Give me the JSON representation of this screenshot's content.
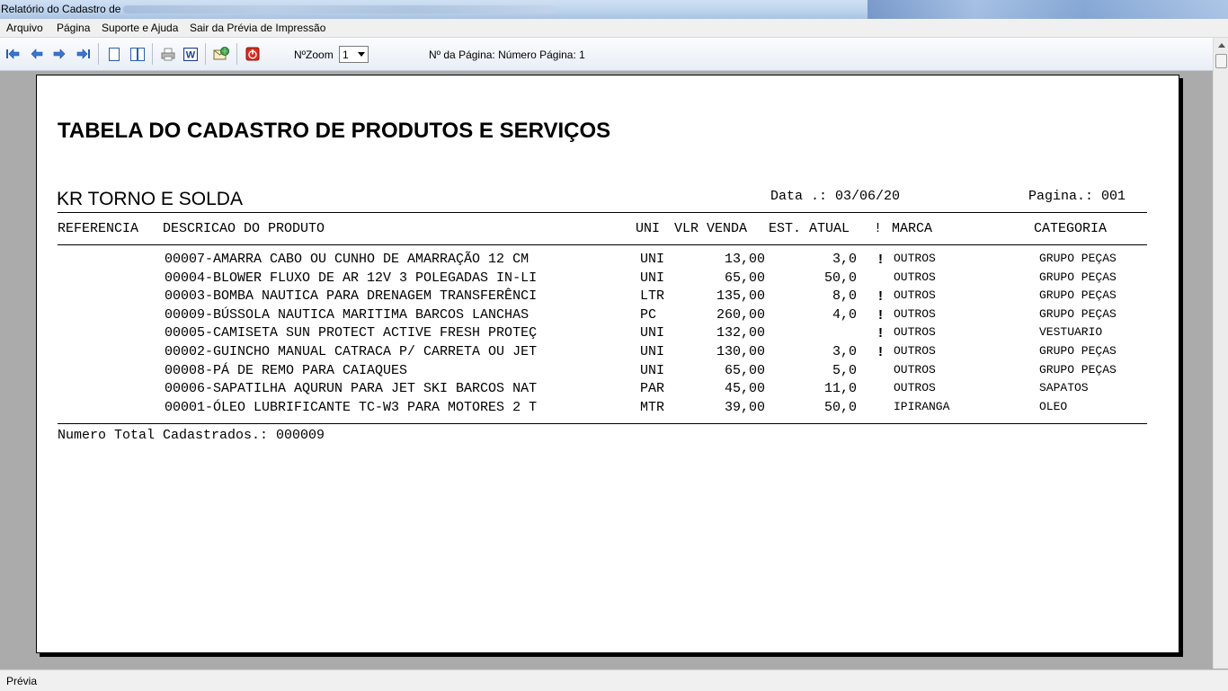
{
  "window": {
    "title": "Relatório do Cadastro de"
  },
  "menu": [
    "Arquivo",
    "Página",
    "Suporte e Ajuda",
    "Sair da Prévia de Impressão"
  ],
  "toolbar": {
    "zoom_label": "NºZoom",
    "zoom_value": "1",
    "page_label": "Nº da Página: Número Página: 1",
    "icons": [
      "first-page-icon",
      "previous-page-icon",
      "next-page-icon",
      "last-page-icon",
      "single-page-icon",
      "two-pages-icon",
      "print-icon",
      "word-export-icon",
      "email-icon",
      "exit-icon"
    ]
  },
  "report": {
    "title": "TABELA DO CADASTRO DE PRODUTOS E SERVIÇOS",
    "company": "KR TORNO E SOLDA",
    "date": "Data .: 03/06/20",
    "page": "Pagina.: 001",
    "headers": {
      "ref": "REFERENCIA",
      "desc": "DESCRICAO DO PRODUTO",
      "uni": "UNI",
      "vlr": "VLR VENDA",
      "est": "EST. ATUAL",
      "bang": "!",
      "marca": "MARCA",
      "cat": "CATEGORIA"
    },
    "rows": [
      {
        "desc": "00007-AMARRA CABO OU CUNHO DE AMARRAÇÃO 12 CM",
        "uni": "UNI",
        "vlr": "13,00",
        "est": "3,0",
        "flag": "!",
        "marca": "OUTROS",
        "cat": "GRUPO PEÇAS"
      },
      {
        "desc": "00004-BLOWER FLUXO DE AR 12V 3 POLEGADAS IN-LI",
        "uni": "UNI",
        "vlr": "65,00",
        "est": "50,0",
        "flag": "",
        "marca": "OUTROS",
        "cat": "GRUPO PEÇAS"
      },
      {
        "desc": "00003-BOMBA NAUTICA PARA DRENAGEM TRANSFERÊNCI",
        "uni": "LTR",
        "vlr": "135,00",
        "est": "8,0",
        "flag": "!",
        "marca": "OUTROS",
        "cat": "GRUPO PEÇAS"
      },
      {
        "desc": "00009-BÚSSOLA NAUTICA MARITIMA BARCOS LANCHAS",
        "uni": "PC",
        "vlr": "260,00",
        "est": "4,0",
        "flag": "!",
        "marca": "OUTROS",
        "cat": "GRUPO PEÇAS"
      },
      {
        "desc": "00005-CAMISETA SUN PROTECT ACTIVE FRESH PROTEÇ",
        "uni": "UNI",
        "vlr": "132,00",
        "est": "",
        "flag": "!",
        "marca": "OUTROS",
        "cat": "VESTUARIO"
      },
      {
        "desc": "00002-GUINCHO MANUAL CATRACA P/ CARRETA OU JET",
        "uni": "UNI",
        "vlr": "130,00",
        "est": "3,0",
        "flag": "!",
        "marca": "OUTROS",
        "cat": "GRUPO PEÇAS"
      },
      {
        "desc": "00008-PÁ DE REMO PARA CAIAQUES",
        "uni": "UNI",
        "vlr": "65,00",
        "est": "5,0",
        "flag": "",
        "marca": "OUTROS",
        "cat": "GRUPO PEÇAS"
      },
      {
        "desc": "00006-SAPATILHA AQURUN PARA JET SKI BARCOS NAT",
        "uni": "PAR",
        "vlr": "45,00",
        "est": "11,0",
        "flag": "",
        "marca": "OUTROS",
        "cat": "SAPATOS"
      },
      {
        "desc": "00001-ÓLEO LUBRIFICANTE TC-W3 PARA MOTORES 2 T",
        "uni": "MTR",
        "vlr": "39,00",
        "est": "50,0",
        "flag": "",
        "marca": "IPIRANGA",
        "cat": "OLEO"
      }
    ],
    "footer": "Numero Total Cadastrados.: 000009"
  },
  "status": {
    "text": "Prévia"
  }
}
